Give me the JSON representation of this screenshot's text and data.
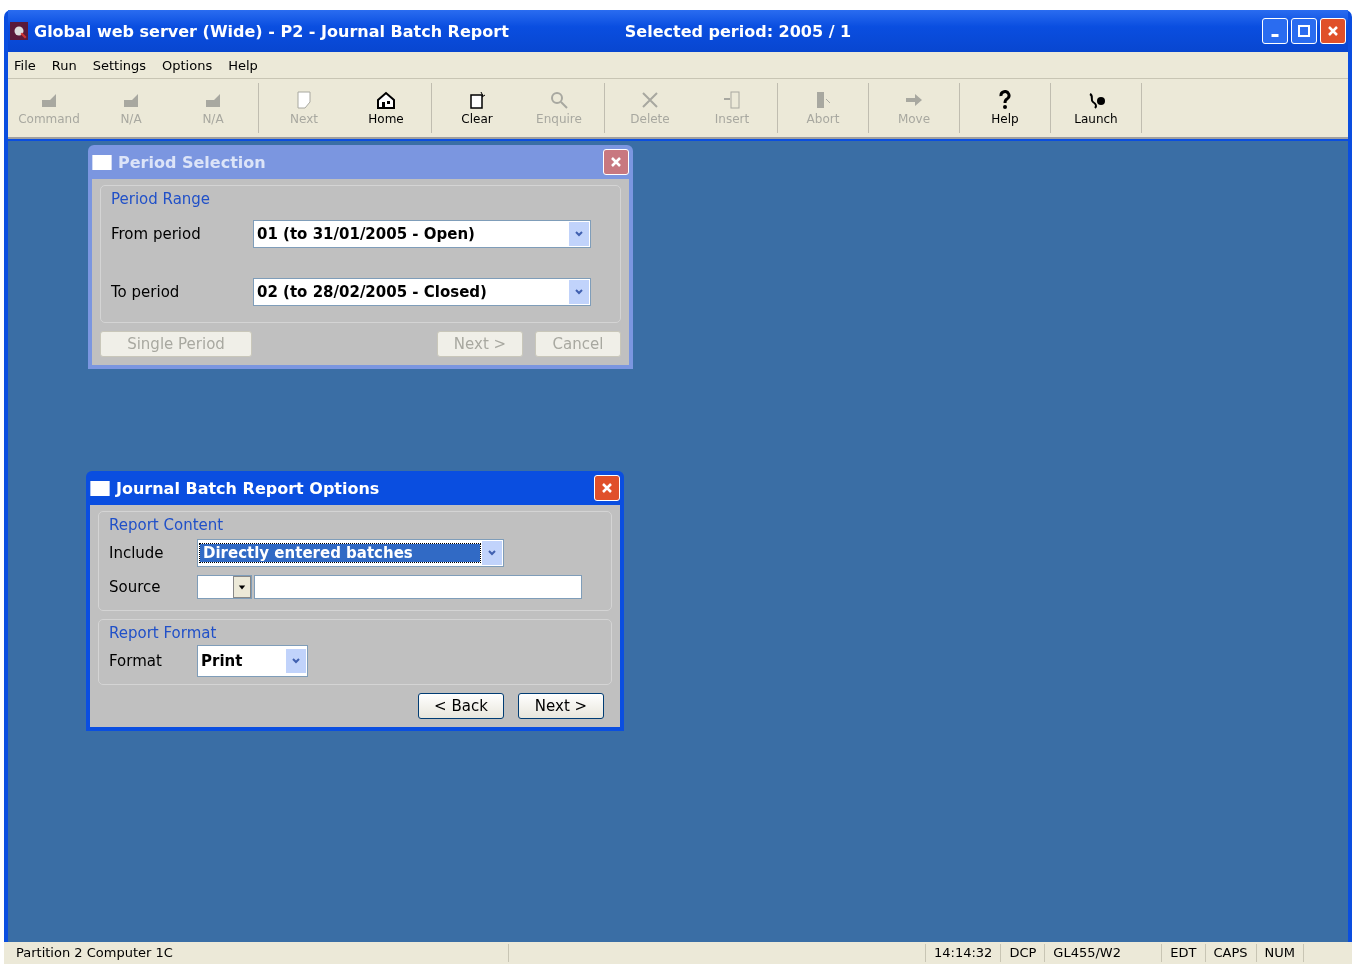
{
  "window": {
    "title": "Global web server (Wide) - P2 - Journal Batch Report",
    "period": "Selected period: 2005     / 1"
  },
  "menu": [
    "File",
    "Run",
    "Settings",
    "Options",
    "Help"
  ],
  "toolbar": [
    {
      "label": "Command",
      "disabled": true,
      "separator_after": false
    },
    {
      "label": "N/A",
      "disabled": true,
      "separator_after": false
    },
    {
      "label": "N/A",
      "disabled": true,
      "separator_after": true
    },
    {
      "label": "Next",
      "disabled": true,
      "separator_after": false
    },
    {
      "label": "Home",
      "disabled": false,
      "separator_after": true
    },
    {
      "label": "Clear",
      "disabled": false,
      "separator_after": false
    },
    {
      "label": "Enquire",
      "disabled": true,
      "separator_after": true
    },
    {
      "label": "Delete",
      "disabled": true,
      "separator_after": false
    },
    {
      "label": "Insert",
      "disabled": true,
      "separator_after": true
    },
    {
      "label": "Abort",
      "disabled": true,
      "separator_after": true
    },
    {
      "label": "Move",
      "disabled": true,
      "separator_after": true
    },
    {
      "label": "Help",
      "disabled": false,
      "separator_after": true
    },
    {
      "label": "Launch",
      "disabled": false,
      "separator_after": true
    }
  ],
  "period_dialog": {
    "title": "Period Selection",
    "active": false,
    "group": "Period Range",
    "fields": [
      {
        "label": "From period",
        "value": "01 (to 31/01/2005 - Open)"
      },
      {
        "label": "To period",
        "value": "02 (to 28/02/2005 - Closed)"
      }
    ],
    "buttons": [
      {
        "label": "Single Period",
        "disabled": true
      },
      {
        "label": "Next >",
        "disabled": true
      },
      {
        "label": "Cancel",
        "disabled": true
      }
    ]
  },
  "options_dialog": {
    "title": "Journal Batch Report Options",
    "active": true,
    "content_group": "Report Content",
    "include_label": "Include",
    "include_value": "Directly entered batches",
    "source_label": "Source",
    "format_group": "Report Format",
    "format_label": "Format",
    "format_value": "Print",
    "buttons": [
      {
        "label": "< Back",
        "disabled": false
      },
      {
        "label": "Next >",
        "disabled": false
      }
    ]
  },
  "status_bar": {
    "message": "Partition 2 Computer 1C",
    "time": "14:14:32",
    "user": "DCP",
    "program": "GL455/W2",
    "indicators": [
      "EDT",
      "CAPS",
      "NUM"
    ]
  }
}
